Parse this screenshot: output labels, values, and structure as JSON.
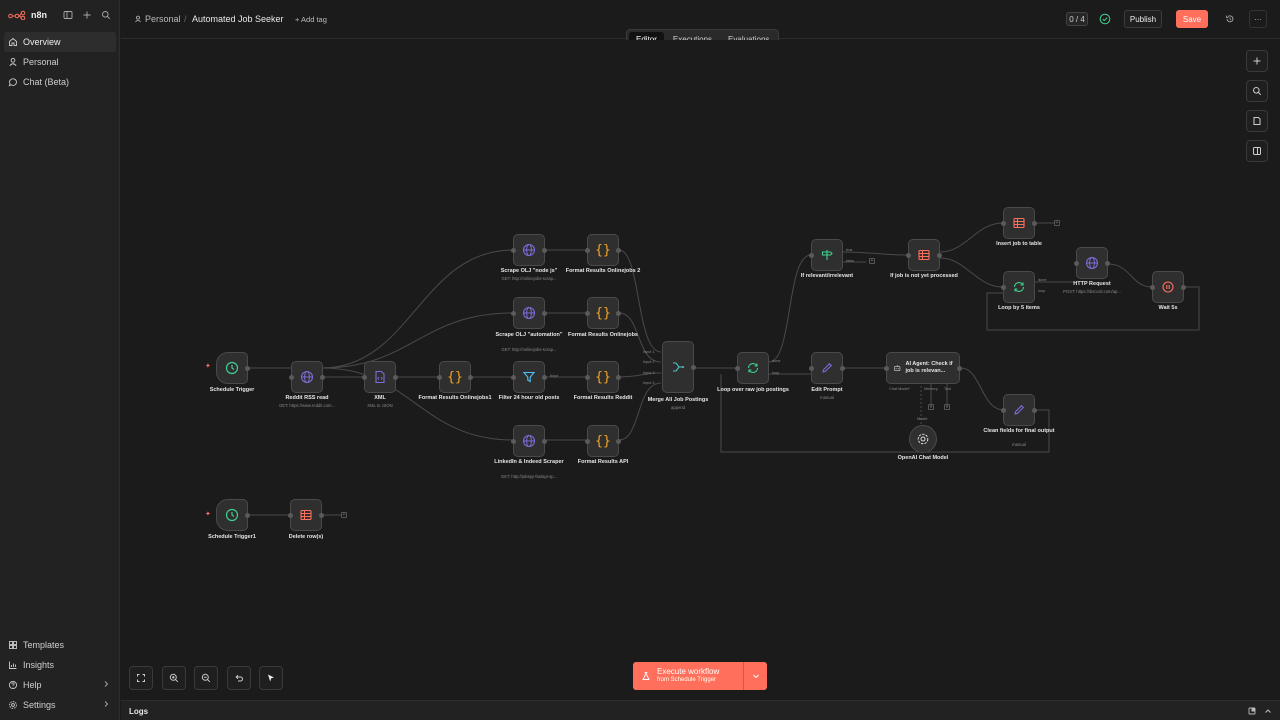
{
  "app": {
    "name": "n8n"
  },
  "sidebar": {
    "nav": [
      {
        "label": "Overview",
        "icon": "home-icon",
        "active": true
      },
      {
        "label": "Personal",
        "icon": "user-icon",
        "active": false
      },
      {
        "label": "Chat (Beta)",
        "icon": "chat-icon",
        "active": false
      }
    ],
    "bottom": [
      {
        "label": "Templates",
        "icon": "templates-icon",
        "chevron": false
      },
      {
        "label": "Insights",
        "icon": "insights-icon",
        "chevron": false
      },
      {
        "label": "Help",
        "icon": "help-icon",
        "chevron": true
      },
      {
        "label": "Settings",
        "icon": "settings-icon",
        "chevron": true
      }
    ]
  },
  "header": {
    "project": "Personal",
    "separator": "/",
    "workflow_name": "Automated Job Seeker",
    "add_tag": "+ Add tag",
    "count": "0 / 4",
    "publish": "Publish",
    "save": "Save",
    "more": "···"
  },
  "tabs": [
    {
      "label": "Editor",
      "active": true
    },
    {
      "label": "Executions",
      "active": false
    },
    {
      "label": "Evaluations",
      "active": false
    }
  ],
  "nodes": {
    "schedule_trigger": {
      "label": "Schedule Trigger"
    },
    "reddit_rss": {
      "label": "Reddit RSS read",
      "sub": "GET: https://www.reddit.com..."
    },
    "xml": {
      "label": "XML",
      "sub": "XML to JSON"
    },
    "format_oj1": {
      "label": "Format Results Onlinejobs1"
    },
    "filter_24h": {
      "label": "Filter 24 hour old posts"
    },
    "format_reddit": {
      "label": "Format Results Reddit"
    },
    "scrape_oj_node": {
      "label": "Scrape OLJ \"node js\"",
      "sub": "GET: http://onlinejobs-scrap..."
    },
    "format_oj2": {
      "label": "Format Results Onlinejobs 2"
    },
    "scrape_oj_auto": {
      "label": "Scrape OLJ \"automation\"",
      "sub": "GET: http://onlinejobs-scrap..."
    },
    "format_oj": {
      "label": "Format Results Onlinejobs"
    },
    "linkedin": {
      "label": "LinkedIn & Indeed Scraper",
      "sub": "GET: http://jobspy-fastapi-sp..."
    },
    "format_api": {
      "label": "Format Results API"
    },
    "merge": {
      "label": "Merge All Job Postings",
      "sub": "append",
      "inputs": [
        "Input 1",
        "Input 2",
        "Input 3",
        "Input 4"
      ]
    },
    "loop_raw": {
      "label": "Loop over raw job postings",
      "ports": [
        "done",
        "loop"
      ]
    },
    "edit_prompt": {
      "label": "Edit Prompt",
      "sub": "manual"
    },
    "ai_agent": {
      "label": "AI Agent: Check if job is relevan...",
      "ports": [
        "Chat Model*",
        "Memory",
        "Tool"
      ]
    },
    "openai": {
      "label": "OpenAI Chat Model",
      "port": "Model"
    },
    "if_relevant": {
      "label": "If relevant/irrelevant",
      "ports": [
        "true",
        "false"
      ]
    },
    "if_not_processed": {
      "label": "If job is not yet processed"
    },
    "insert_job": {
      "label": "Insert job to table"
    },
    "loop5": {
      "label": "Loop by 5 items",
      "ports": [
        "done",
        "loop"
      ]
    },
    "http": {
      "label": "HTTP Request",
      "sub": "POST: https://discord.com/ap..."
    },
    "wait": {
      "label": "Wait 5s"
    },
    "clean_fields": {
      "label": "Clean fields for final output",
      "sub": "manual"
    },
    "schedule_trigger1": {
      "label": "Schedule Trigger1"
    },
    "delete_rows": {
      "label": "Delete row(s)"
    }
  },
  "execute": {
    "line1": "Execute workflow",
    "line2": "from Schedule Trigger"
  },
  "logs": {
    "label": "Logs"
  },
  "colors": {
    "accent": "#ff6f5c",
    "globe": "#7d6bd8",
    "code": "#f5a524",
    "green": "#3fcf8e",
    "table": "#ff6f5c",
    "teal": "#4fc3c7"
  }
}
